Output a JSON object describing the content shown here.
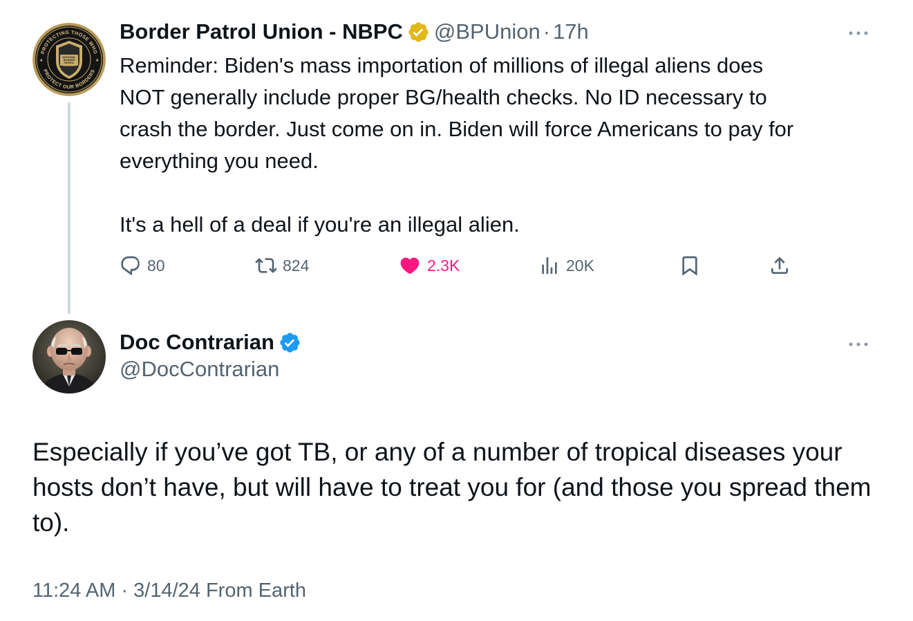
{
  "parent_tweet": {
    "display_name": "Border Patrol Union - NBPC",
    "verified_badge": "gold-verified-badge",
    "handle": "@BPUnion",
    "separator": "·",
    "time": "17h",
    "avatar": {
      "icon": "border-patrol-council-seal",
      "seal_top_text": "PROTECTING THOSE WHO",
      "seal_bottom_text": "PROTECT OUR BORDERS",
      "seal_center_text": "NATIONAL BORDER PATROL COUNCIL"
    },
    "text": "Reminder: Biden's mass importation of millions of illegal aliens does\nNOT generally include proper BG/health checks. No ID necessary to\ncrash the border. Just come on in. Biden will force Americans to pay for\neverything you need.\n\nIt's a hell of a deal if you're an illegal alien.",
    "actions": {
      "replies": "80",
      "reposts": "824",
      "likes": "2.3K",
      "views": "20K"
    },
    "like_color": "#f91880"
  },
  "reply_tweet": {
    "display_name": "Doc Contrarian",
    "verified_badge": "blue-verified-badge",
    "handle": "@DocContrarian",
    "avatar": {
      "icon": "bald-man-with-glasses-portrait"
    },
    "text": "Especially if you’ve got TB, or any of a number of tropical diseases your hosts don’t have, but will have to treat you for (and those you spread them to).",
    "meta": "11:24 AM · 3/14/24 From Earth"
  },
  "colors": {
    "text_primary": "#0f1419",
    "text_secondary": "#536471",
    "verified_blue": "#1d9bf0",
    "verified_gold": "#e2b719",
    "thread_line": "#cfd9de"
  }
}
